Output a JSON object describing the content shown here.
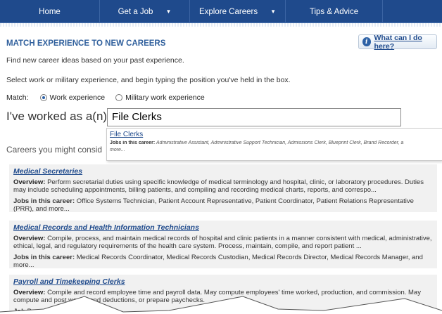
{
  "nav": {
    "items": [
      {
        "label": "Home",
        "has_caret": false
      },
      {
        "label": "Get a Job",
        "has_caret": true
      },
      {
        "label": "Explore Careers",
        "has_caret": true
      },
      {
        "label": "Tips & Advice",
        "has_caret": false
      }
    ],
    "caret_glyph": "▼"
  },
  "heading": "MATCH EXPERIENCE TO NEW CAREERS",
  "help_button": {
    "icon": "info-icon",
    "icon_glyph": "i",
    "label": "What can I do here?"
  },
  "intro_1": "Find new career ideas based on your past experience.",
  "intro_2": "Select work or military experience, and begin typing the position you've held in the box.",
  "match": {
    "label": "Match:",
    "options": [
      {
        "label": "Work experience",
        "selected": true
      },
      {
        "label": "Military work experience",
        "selected": false
      }
    ]
  },
  "worked_label": "I've worked as a(n)",
  "job_input_value": "File Clerks",
  "careers_label": "Careers you might consid",
  "suggestion": {
    "title": "File Clerks",
    "jobs_label": "Jobs in this career:",
    "jobs_text": "Administrative Assistant, Administrative Support Technician, Admissions Clerk, Blueprint Clerk, Brand Recorder, a",
    "more": "more..."
  },
  "careers": [
    {
      "title": "Medical Secretaries",
      "overview_label": "Overview:",
      "overview": "Perform secretarial duties using specific knowledge of medical terminology and hospital, clinic, or laboratory procedures. Duties may include scheduling appointments, billing patients, and compiling and recording medical charts, reports, and correspo...",
      "jobs_label": "Jobs in this career:",
      "jobs": "Office Systems Technician, Patient Account Representative, Patient Coordinator, Patient Relations Representative (PRR), and more..."
    },
    {
      "title": "Medical Records and Health Information Technicians",
      "overview_label": "Overview:",
      "overview": "Compile, process, and maintain medical records of hospital and clinic patients in a manner consistent with medical, administrative, ethical, legal, and regulatory requirements of the health care system. Process, maintain, compile, and report patient ...",
      "jobs_label": "Jobs in this career:",
      "jobs": "Medical Records Coordinator, Medical Records Custodian, Medical Records Director, Medical Records Manager, and more..."
    },
    {
      "title": "Payroll and Timekeeping Clerks",
      "overview_label": "Overview:",
      "overview": "Compile and record employee time and payroll data. May compute employees' time worked, production, and commission. May compute and post wages and deductions, or prepare paychecks.",
      "jobs_label": "Job",
      "jobs": "Payroll and Benefits S"
    }
  ],
  "colors": {
    "nav_bg": "#1f4a8c",
    "link": "#1f4a8c",
    "heading": "#2f5f9c",
    "card_bg": "#f1f1f1"
  }
}
